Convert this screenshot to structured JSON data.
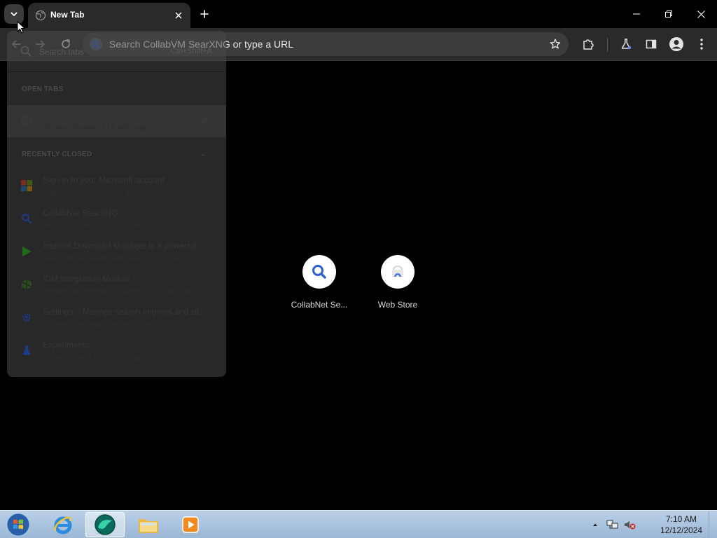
{
  "browser": {
    "tab": {
      "title": "New Tab"
    },
    "omnibox": {
      "placeholder": "Search CollabVM SearXNG or type a URL"
    }
  },
  "tab_search": {
    "search_placeholder": "Search tabs",
    "shortcut": "Ctrl+Shift+A",
    "open_tabs_header": "OPEN TABS",
    "open_tabs": [
      {
        "title": "New Tab",
        "url": "chrome://newtab",
        "time": "15 secs ago",
        "icon": "globe-icon"
      }
    ],
    "recently_closed_header": "RECENTLY CLOSED",
    "recently_closed": [
      {
        "title": "Sign in to your Microsoft account",
        "url": "login.live.com",
        "time": "30 secs ago",
        "icon": "microsoft-icon"
      },
      {
        "title": "CollabNet SearXNG",
        "url": "search.collabnet.local",
        "time": "30 secs ago",
        "icon": "search-icon"
      },
      {
        "title": "Internet Download Manager is a powerful...",
        "url": "www.internetdownloadmanager...",
        "time": "3 mins ago",
        "icon": "idm-icon"
      },
      {
        "title": "IDM Integration Module",
        "url": "ngpampappnmepgilojfohadhh...",
        "time": "3 mins ago",
        "icon": "puzzle-icon"
      },
      {
        "title": "Settings – Manage search engines and sit...",
        "url": "chrome://settings",
        "time": "240 days ago",
        "icon": "gear-icon"
      },
      {
        "title": "Experiments",
        "url": "chrome://flags",
        "time": "318 days ago",
        "icon": "flask-icon"
      }
    ]
  },
  "ntp": {
    "shortcuts": [
      {
        "label": "CollabNet Se...",
        "icon": "search-icon"
      },
      {
        "label": "Web Store",
        "icon": "webstore-icon"
      }
    ]
  },
  "taskbar": {
    "time": "7:10 AM",
    "date": "12/12/2024"
  },
  "colors": {
    "accent_blue": "#2f5fd0",
    "tab_bg": "#2a2a2a",
    "toolbar_bg": "#2a2a2a",
    "omnibox_bg": "#3c3c3c"
  }
}
